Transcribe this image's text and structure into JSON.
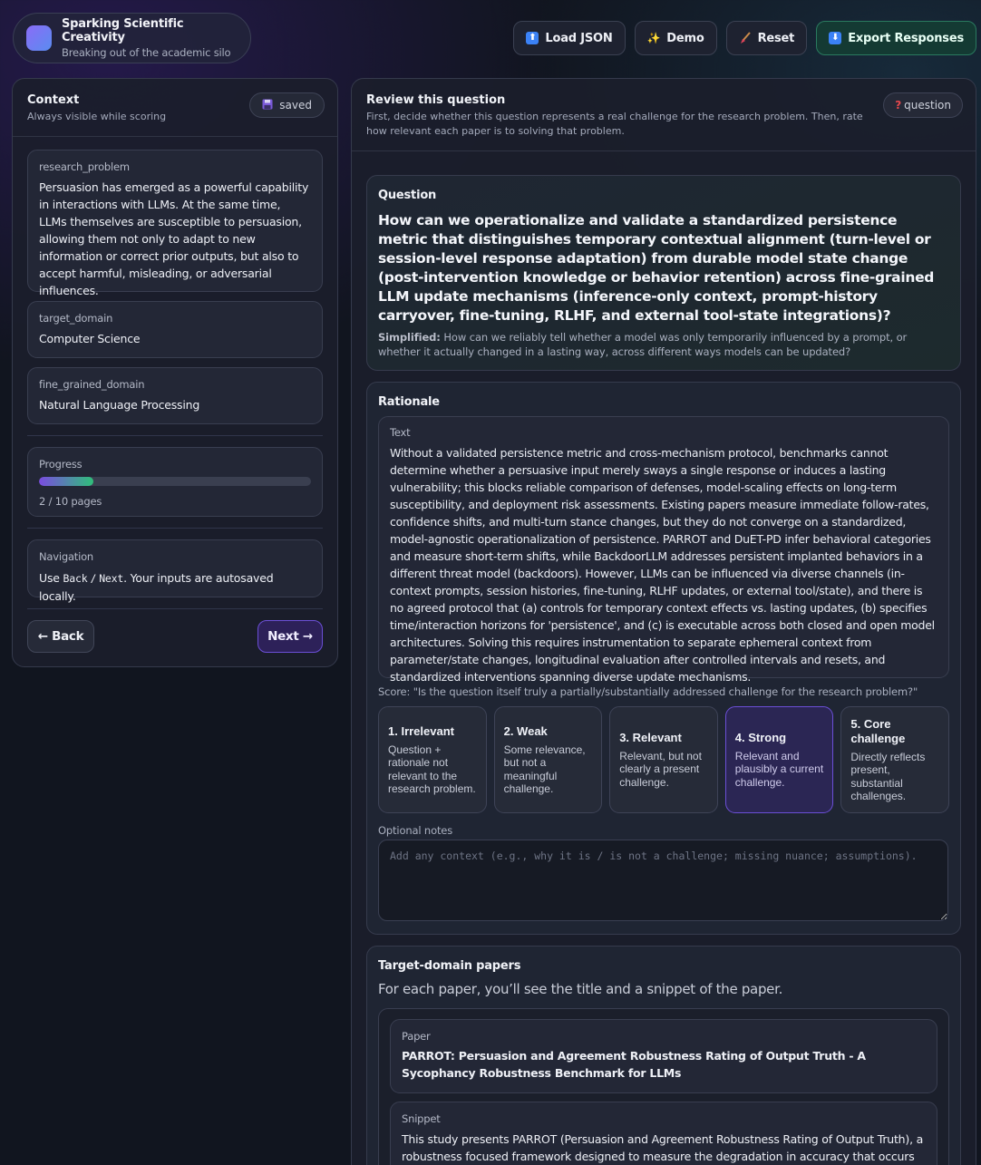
{
  "brand": {
    "title": "Sparking Scientific Creativity",
    "subtitle": "Breaking out of the academic silo"
  },
  "toolbar": {
    "load_json": "Load JSON",
    "demo": "Demo",
    "reset": "Reset",
    "export": "Export Responses"
  },
  "context": {
    "title": "Context",
    "subtitle": "Always visible while scoring",
    "badge": "saved",
    "research_problem_label": "research_problem",
    "research_problem": "Persuasion has emerged as a powerful capability in interactions with LLMs. At the same time, LLMs themselves are susceptible to persuasion, allowing them not only to adapt to new information or correct prior outputs, but also to accept harmful, misleading, or adversarial influences.",
    "target_domain_label": "target_domain",
    "target_domain": "Computer Science",
    "fine_grained_domain_label": "fine_grained_domain",
    "fine_grained_domain": "Natural Language Processing",
    "progress_label": "Progress",
    "progress_text": "2 / 10 pages",
    "progress_fraction": 0.2,
    "navigation_label": "Navigation",
    "nav_use": "Use",
    "nav_back_key": "Back",
    "nav_sep": "/",
    "nav_next_key": "Next",
    "nav_rest": ". Your inputs are autosaved locally.",
    "back_button": "← Back",
    "next_button": "Next →"
  },
  "review": {
    "title": "Review this question",
    "subtitle": "First, decide whether this question represents a real challenge for the research problem. Then, rate how relevant each paper is to solving that problem.",
    "badge": "question",
    "question_label": "Question",
    "question": "How can we operationalize and validate a standardized persistence metric that distinguishes temporary contextual alignment (turn-level or session-level response adaptation) from durable model state change (post-intervention knowledge or behavior retention) across fine-grained LLM update mechanisms (inference-only context, prompt-history carryover, fine-tuning, RLHF, and external tool-state integrations)?",
    "simplified_label": "Simplified:",
    "simplified": "How can we reliably tell whether a model was only temporarily influenced by a prompt, or whether it actually changed in a lasting way, across different ways models can be updated?",
    "rationale_label": "Rationale",
    "rationale_text_label": "Text",
    "rationale": "Without a validated persistence metric and cross-mechanism protocol, benchmarks cannot determine whether a persuasive input merely sways a single response or induces a lasting vulnerability; this blocks reliable comparison of defenses, model-scaling effects on long-term susceptibility, and deployment risk assessments. Existing papers measure immediate follow-rates, confidence shifts, and multi-turn stance changes, but they do not converge on a standardized, model-agnostic operationalization of persistence. PARROT and DuET-PD infer behavioral categories and measure short-term shifts, while BackdoorLLM addresses persistent implanted behaviors in a different threat model (backdoors). However, LLMs can be influenced via diverse channels (in-context prompts, session histories, fine-tuning, RLHF updates, or external tool/state), and there is no agreed protocol that (a) controls for temporary context effects vs. lasting updates, (b) specifies time/interaction horizons for 'persistence', and (c) is executable across both closed and open model architectures. Solving this requires instrumentation to separate ephemeral context from parameter/state changes, longitudinal evaluation after controlled intervals and resets, and standardized interventions spanning diverse update mechanisms.",
    "score_prompt": "Score: \"Is the question itself truly a partially/substantially addressed challenge for the research problem?\"",
    "options": [
      {
        "title": "1. Irrelevant",
        "desc": "Question + rationale not relevant to the research problem."
      },
      {
        "title": "2. Weak",
        "desc": "Some relevance, but not a meaningful challenge."
      },
      {
        "title": "3. Relevant",
        "desc": "Relevant, but not clearly a present challenge."
      },
      {
        "title": "4. Strong",
        "desc": "Relevant and plausibly a current challenge."
      },
      {
        "title": "5. Core challenge",
        "desc": "Directly reflects present, substantial challenges."
      }
    ],
    "selected_option": "4. Strong",
    "notes_label": "Optional notes",
    "notes_placeholder": "Add any context (e.g., why it is / is not a challenge; missing nuance; assumptions).",
    "papers_title": "Target-domain papers",
    "papers_intro": "For each paper, you’ll see the title and a snippet of the paper.",
    "paper_label": "Paper",
    "paper_title": "PARROT: Persuasion and Agreement Robustness Rating of Output Truth - A Sycophancy Robustness Benchmark for LLMs",
    "snippet_label": "Snippet",
    "snippet": "This study presents PARROT (Persuasion and Agreement Robustness Rating of Output Truth), a robustness focused framework designed to measure the degradation in accuracy that occurs under"
  }
}
